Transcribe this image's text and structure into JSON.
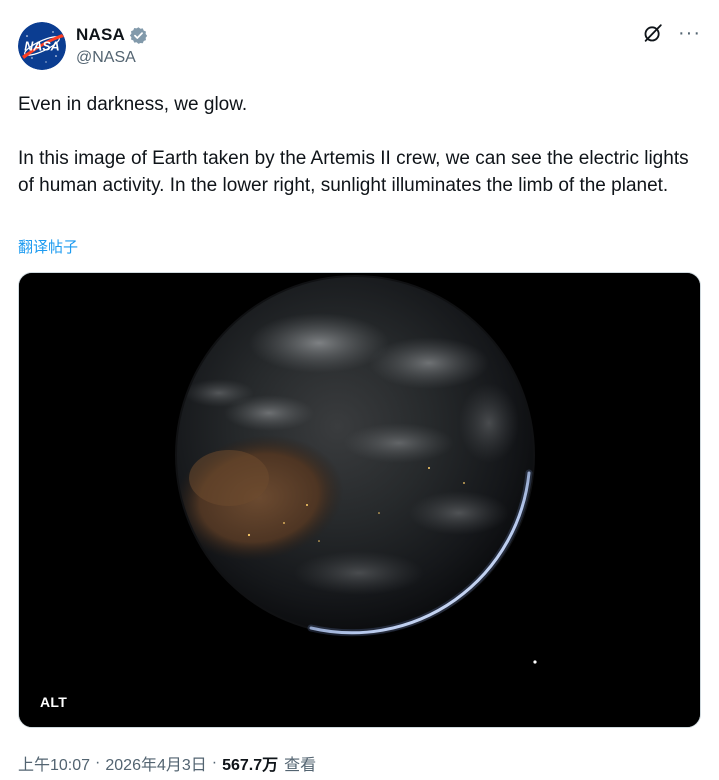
{
  "author": {
    "display_name": "NASA",
    "handle": "@NASA",
    "avatar_icon": "nasa-meatball-logo",
    "verified_icon": "verified-badge-icon",
    "verified_color": "#1d9bf0",
    "avatar_logo_text": "NASA"
  },
  "header_actions": {
    "grok_icon": "grok-icon",
    "more_icon": "more-options-icon",
    "more_glyph": "···"
  },
  "post": {
    "line1": "Even in darkness, we glow.",
    "line2": "In this image of Earth taken by the Artemis II crew, we can see the electric lights of human activity. In the lower right, sunlight illuminates the limb of the planet.",
    "translate_label": "翻译帖子"
  },
  "media": {
    "description_icon": "earth-at-night-photo",
    "alt_label": "ALT"
  },
  "footer": {
    "time": "上午10:07",
    "separator": "·",
    "date": "2026年4月3日",
    "views_count": "567.7万",
    "views_label": "查看"
  },
  "colors": {
    "text_primary": "#0f1419",
    "text_secondary": "#536471",
    "link": "#1d9bf0",
    "nasa_blue": "#0b3d91",
    "nasa_red": "#fc3d21"
  }
}
